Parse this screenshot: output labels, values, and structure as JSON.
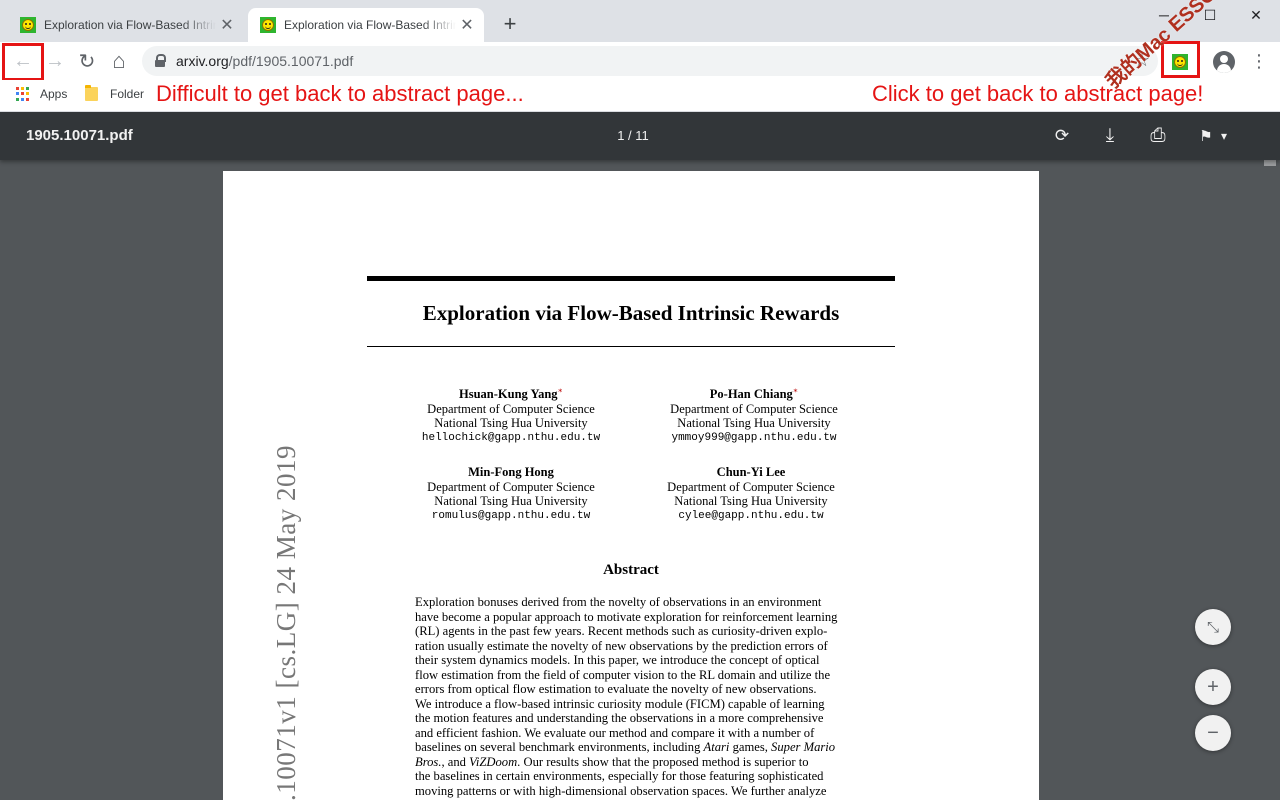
{
  "browser": {
    "tabs": [
      {
        "title": "Exploration via Flow-Based Intrinsic Rewards",
        "active": false
      },
      {
        "title": "Exploration via Flow-Based Intrinsic Rewards",
        "active": true
      }
    ],
    "new_tab_label": "+",
    "window_controls": {
      "minimize": "─",
      "maximize": "☐",
      "close": "✕"
    },
    "nav": {
      "back": "←",
      "forward": "→",
      "reload": "↻",
      "home": "⌂"
    },
    "url": {
      "host": "arxiv.org",
      "path": "/pdf/1905.10071.pdf"
    },
    "star_icon": "☆",
    "menu_icon": "⋮",
    "bookmarks": [
      {
        "label": "Apps",
        "icon": "apps-grid-icon"
      },
      {
        "label": "Folder",
        "icon": "folder-icon"
      }
    ],
    "apps_colors": [
      "#ea4335",
      "#fbbc05",
      "#34a853",
      "#4285f4",
      "#ea4335",
      "#fbbc05",
      "#34a853",
      "#4285f4",
      "#ea4335"
    ]
  },
  "annotations": {
    "left": "Difficult to get back to abstract page...",
    "right": "Click to get back to abstract page!",
    "color": "#e51414"
  },
  "watermark": "我的Mac ESSG",
  "pdf_viewer": {
    "filename": "1905.10071.pdf",
    "page_indicator": "1 / 11",
    "tools": {
      "rotate": "⟳",
      "download": "⤓",
      "print": "⎙",
      "bookmark": "⚑",
      "bookmark_caret": "▾"
    },
    "zoom": {
      "fit": "⤡",
      "in": "+",
      "out": "−"
    }
  },
  "paper": {
    "title": "Exploration via Flow-Based Intrinsic Rewards",
    "authors": [
      {
        "name": "Hsuan-Kung Yang",
        "mark": "∗",
        "dept": "Department of Computer Science",
        "univ": "National Tsing Hua University",
        "email": "hellochick@gapp.nthu.edu.tw"
      },
      {
        "name": "Po-Han Chiang",
        "mark": "∗",
        "dept": "Department of Computer Science",
        "univ": "National Tsing Hua University",
        "email": "ymmoy999@gapp.nthu.edu.tw"
      },
      {
        "name": "Min-Fong Hong",
        "mark": "",
        "dept": "Department of Computer Science",
        "univ": "National Tsing Hua University",
        "email": "romulus@gapp.nthu.edu.tw"
      },
      {
        "name": "Chun-Yi Lee",
        "mark": "",
        "dept": "Department of Computer Science",
        "univ": "National Tsing Hua University",
        "email": "cylee@gapp.nthu.edu.tw"
      }
    ],
    "abstract_heading": "Abstract",
    "abstract_lines": [
      "Exploration bonuses derived from the novelty of observations in an environment",
      "have become a popular approach to motivate exploration for reinforcement learning",
      "(RL) agents in the past few years. Recent methods such as curiosity-driven explo-",
      "ration usually estimate the novelty of new observations by the prediction errors of",
      "their system dynamics models. In this paper, we introduce the concept of optical",
      "flow estimation from the field of computer vision to the RL domain and utilize the",
      "errors from optical flow estimation to evaluate the novelty of new observations.",
      "We introduce a flow-based intrinsic curiosity module (FICM) capable of learning",
      "the motion features and understanding the observations in a more comprehensive",
      "and efficient fashion. We evaluate our method and compare it with a number of"
    ],
    "abstract_tail": {
      "l11_a": "baselines on several benchmark environments, including ",
      "l11_b": "Atari",
      "l11_c": " games, ",
      "l11_d": "Super Mario",
      "l12_a": "Bros.",
      "l12_b": ", and ",
      "l12_c": "ViZDoom",
      "l12_d": ". Our results show that the proposed method is superior to",
      "l13": "the baselines in certain environments, especially for those featuring sophisticated",
      "l14": "moving patterns or with high-dimensional observation spaces. We further analyze"
    },
    "arxiv_stamp": ".10071v1  [cs.LG]  24 May 2019"
  }
}
